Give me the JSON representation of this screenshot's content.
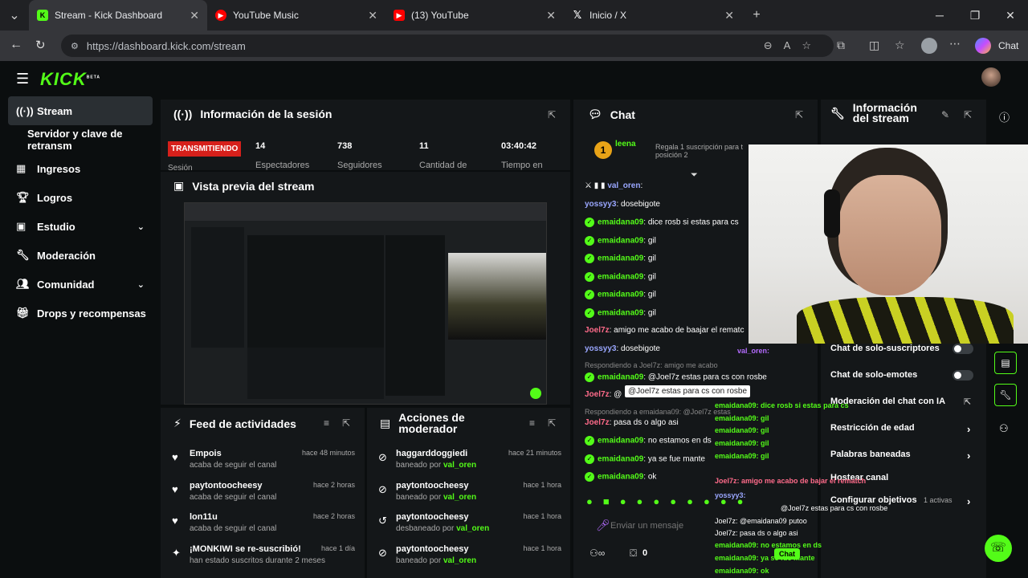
{
  "browser": {
    "tabs": [
      {
        "title": "Stream - Kick Dashboard",
        "icon": "kick-favicon",
        "active": true
      },
      {
        "title": "YouTube Music",
        "icon": "youtube-music-favicon"
      },
      {
        "title": "(13) YouTube",
        "icon": "youtube-favicon"
      },
      {
        "title": "Inicio / X",
        "icon": "x-favicon"
      }
    ],
    "url": "https://dashboard.kick.com/stream",
    "chat_button": "Chat"
  },
  "app": {
    "logo": "KICK",
    "logo_badge": "BETA",
    "brand_color": "#53fc18"
  },
  "sidebar": {
    "items": [
      {
        "label": "Stream",
        "icon": "broadcast-icon"
      },
      {
        "label": "Servidor y clave de retransm"
      },
      {
        "label": "Ingresos",
        "icon": "chart-icon"
      },
      {
        "label": "Logros",
        "icon": "trophy-icon"
      },
      {
        "label": "Estudio",
        "icon": "grid-icon"
      },
      {
        "label": "Moderación",
        "icon": "wrench-icon"
      },
      {
        "label": "Comunidad",
        "icon": "people-icon"
      },
      {
        "label": "Drops y recompensas",
        "icon": "gift-icon"
      }
    ]
  },
  "session": {
    "title": "Información de la sesión",
    "status": "TRANSMITIENDO",
    "status_sub": "Sesión",
    "stats": [
      {
        "value": "14",
        "label": "Espectadores"
      },
      {
        "value": "738",
        "label": "Seguidores"
      },
      {
        "value": "11",
        "label": "Cantidad de"
      },
      {
        "value": "03:40:42",
        "label": "Tiempo en"
      }
    ]
  },
  "preview": {
    "title": "Vista previa del stream"
  },
  "feed": {
    "title": "Feed de actividades",
    "items": [
      {
        "name": "Empois",
        "action": "acaba de seguir el canal",
        "time": "hace 48 minutos",
        "icon": "heart-icon"
      },
      {
        "name": "paytontoocheesy",
        "action": "acaba de seguir el canal",
        "time": "hace 2 horas",
        "icon": "heart-icon"
      },
      {
        "name": "lon11u",
        "action": "acaba de seguir el canal",
        "time": "hace 2 horas",
        "icon": "heart-icon"
      },
      {
        "name": "¡MONKIWI se re-suscribió!",
        "action": "han estado suscritos durante 2 meses",
        "time": "hace 1 día",
        "icon": "sparkle-icon"
      }
    ]
  },
  "modactions": {
    "title_line1": "Acciones de",
    "title_line2": "moderador",
    "items": [
      {
        "name": "haggarddoggiedi",
        "action": "baneado por",
        "by": "val_oren",
        "time": "hace 21 minutos",
        "icon": "ban-icon"
      },
      {
        "name": "paytontoocheesy",
        "action": "baneado por",
        "by": "val_oren",
        "time": "hace 1 hora",
        "icon": "ban-icon"
      },
      {
        "name": "paytontoocheesy",
        "action": "desbaneado por",
        "by": "val_oren",
        "time": "hace 1 hora",
        "icon": "undo-icon"
      },
      {
        "name": "paytontoocheesy",
        "action": "baneado por",
        "by": "val_oren",
        "time": "hace 1 hora",
        "icon": "ban-icon"
      }
    ]
  },
  "chat": {
    "title": "Chat",
    "pinned_user": "leena",
    "pinned_rank": "1",
    "pinned_text": "Regala 1 suscripción para t",
    "pinned_text2": "posición 2",
    "messages": [
      {
        "user": "val_oren",
        "text": ":",
        "color": "blue"
      },
      {
        "user": "yossyy3",
        "text": "dosebigote",
        "color": "green"
      },
      {
        "user": "emaidana09",
        "text": "dice rosb si estas para cs",
        "color": "green",
        "badge": true
      },
      {
        "user": "emaidana09",
        "text": "gil",
        "color": "green",
        "badge": true
      },
      {
        "user": "emaidana09",
        "text": "gil",
        "color": "green",
        "badge": true
      },
      {
        "user": "emaidana09",
        "text": "gil",
        "color": "green",
        "badge": true
      },
      {
        "user": "emaidana09",
        "text": "gil",
        "color": "green",
        "badge": true
      },
      {
        "user": "emaidana09",
        "text": "gil",
        "color": "green",
        "badge": true
      },
      {
        "user": "Joel7z",
        "text": "amigo me acabo de baajar el rematc",
        "color": "red"
      },
      {
        "user": "yossyy3",
        "text": "dosebigote",
        "color": "green"
      }
    ],
    "reply1": "Respondiendo a Joel7z: amigo me acabo",
    "reply1_user": "emaidana09",
    "reply1_text": "@Joel7z estas para cs con rosbe",
    "reply2_user": "Joel7z",
    "reply2_text": "@",
    "tooltip": "@Joel7z estas para cs con rosbe",
    "reply3": "Respondiendo a emaidana09: @Joel7z estas",
    "reply3_user": "Joel7z",
    "reply3_text": "pasa ds o algo asi",
    "tail": [
      {
        "user": "emaidana09",
        "text": "no estamos en ds"
      },
      {
        "user": "emaidana09",
        "text": "ya se fue mante"
      },
      {
        "user": "emaidana09",
        "text": "ok"
      }
    ],
    "input_placeholder": "Enviar un mensaje",
    "footer_count": "0"
  },
  "streaminfo": {
    "title_line1": "Información",
    "title_line2": "del stream",
    "toggles": [
      {
        "label": "Chat de solo-suscriptores"
      },
      {
        "label": "Chat de solo-emotes"
      }
    ],
    "links": [
      {
        "label": "Moderación del chat con IA"
      },
      {
        "label": "Restricción de edad"
      },
      {
        "label": "Palabras baneadas"
      },
      {
        "label": "Hostear canal"
      },
      {
        "label": "Configurar objetivos",
        "extra": "1 activas"
      }
    ]
  },
  "overlay": {
    "lines": [
      "val_oren:",
      "emaidana09: dice rosb si estas para cs",
      "emaidana09: gil",
      "emaidana09: gil",
      "emaidana09: gil",
      "emaidana09: gil",
      "Joel7z: amigo me acabo de bajar el rematch",
      "yossyy3:",
      "@Joel7z estas para cs con rosbe",
      "Joel7z: @emaidana09 putoo",
      "Joel7z: pasa ds o algo asi",
      "emaidana09: no estamos en ds",
      "emaidana09: ya se fue mante",
      "emaidana09: ok"
    ],
    "chat_button": "Chat"
  }
}
